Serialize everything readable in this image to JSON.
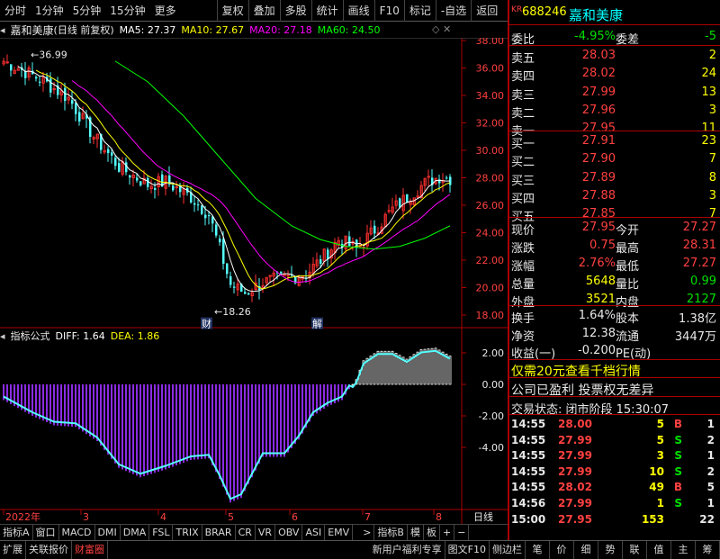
{
  "toolbar": {
    "items": [
      "分时",
      "1分钟",
      "5分钟",
      "15分钟",
      "更多",
      "复权",
      "叠加",
      "多股",
      "统计",
      "画线",
      "F10",
      "标记",
      "-自选",
      "返回"
    ]
  },
  "chart": {
    "stock_name": "嘉和美康",
    "period": "(日线 前复权)",
    "ma5": "MA5: 27.37",
    "ma10": "MA10: 27.67",
    "ma20": "MA20: 27.18",
    "ma60": "MA60: 24.50",
    "high_label": "36.99",
    "low_label": "18.26",
    "marker_cai": "财",
    "marker_jie": "解",
    "y_ticks": [
      "38.00",
      "36.00",
      "34.00",
      "32.00",
      "30.00",
      "28.00",
      "26.00",
      "24.00",
      "22.00",
      "20.00",
      "18.00"
    ],
    "x_labels": [
      "2022年",
      "3",
      "4",
      "5",
      "6",
      "7",
      "8"
    ],
    "period_label": "日线",
    "colors": {
      "ma5": "#ffffff",
      "ma10": "#ffff00",
      "ma20": "#ff00ff",
      "ma60": "#00ff00",
      "up": "#ff3030",
      "down": "#54ffff"
    }
  },
  "indicator": {
    "name": "指标公式",
    "diff": "DIFF: 1.64",
    "dea": "DEA: 1.86",
    "y_ticks": [
      "2.00",
      "0.00",
      "-2.00",
      "-4.00"
    ]
  },
  "tabs": [
    "指标A",
    "窗口",
    "MACD",
    "DMI",
    "DMA",
    "FSL",
    "TRIX",
    "BRAR",
    "CR",
    "VR",
    "OBV",
    "ASI",
    "EMV",
    ">",
    "指标B",
    "模",
    "板",
    "+",
    "−"
  ],
  "statusbar": {
    "left": [
      "扩展",
      "关联报价",
      "财富圈"
    ],
    "right": [
      "新用户福利专享",
      "图文F10",
      "侧边栏"
    ],
    "buttons": [
      "笔",
      "价",
      "细",
      "势",
      "联",
      "值",
      "主",
      "筹"
    ]
  },
  "quote": {
    "code_prefix": "KR",
    "code": "688246",
    "name": "嘉和美康",
    "weibi_label": "委比",
    "weibi": "-4.95%",
    "weicha_label": "委差",
    "weicha": "-5",
    "asks": [
      {
        "label": "卖五",
        "price": "28.03",
        "vol": "2"
      },
      {
        "label": "卖四",
        "price": "28.02",
        "vol": "24"
      },
      {
        "label": "卖三",
        "price": "27.99",
        "vol": "13"
      },
      {
        "label": "卖二",
        "price": "27.96",
        "vol": "3"
      },
      {
        "label": "卖一",
        "price": "27.95",
        "vol": "11"
      }
    ],
    "bids": [
      {
        "label": "买一",
        "price": "27.91",
        "vol": "23"
      },
      {
        "label": "买二",
        "price": "27.90",
        "vol": "7"
      },
      {
        "label": "买三",
        "price": "27.89",
        "vol": "8"
      },
      {
        "label": "买四",
        "price": "27.88",
        "vol": "3"
      },
      {
        "label": "买五",
        "price": "27.85",
        "vol": "7"
      }
    ],
    "stats": [
      {
        "l1": "现价",
        "v1": "27.95",
        "l2": "今开",
        "v2": "27.27"
      },
      {
        "l1": "涨跌",
        "v1": "0.75",
        "l2": "最高",
        "v2": "28.31"
      },
      {
        "l1": "涨幅",
        "v1": "2.76%",
        "l2": "最低",
        "v2": "27.27"
      },
      {
        "l1": "总量",
        "v1": "5648",
        "l2": "量比",
        "v2": "0.99"
      },
      {
        "l1": "外盘",
        "v1": "3521",
        "l2": "内盘",
        "v2": "2127"
      }
    ],
    "stats2": [
      {
        "l1": "换手",
        "v1": "1.64%",
        "l2": "股本",
        "v2": "1.38亿"
      },
      {
        "l1": "净资",
        "v1": "12.38",
        "l2": "流通",
        "v2": "3447万"
      },
      {
        "l1": "收益(一)",
        "v1": "-0.200",
        "l2": "PE(动)",
        "v2": ""
      }
    ],
    "promo": "仅需20元查看千档行情",
    "notice": "公司已盈利 投票权无差异",
    "trade_status": "交易状态: 闭市阶段 15:30:07",
    "ticks": [
      {
        "t": "14:55",
        "p": "28.00",
        "v": "5",
        "f": "B",
        "n": "1"
      },
      {
        "t": "14:55",
        "p": "27.99",
        "v": "5",
        "f": "S",
        "n": "2"
      },
      {
        "t": "14:55",
        "p": "27.99",
        "v": "3",
        "f": "S",
        "n": "1"
      },
      {
        "t": "14:55",
        "p": "27.99",
        "v": "10",
        "f": "S",
        "n": "2"
      },
      {
        "t": "14:55",
        "p": "28.02",
        "v": "49",
        "f": "B",
        "n": "5"
      },
      {
        "t": "14:56",
        "p": "27.99",
        "v": "1",
        "f": "S",
        "n": "1"
      },
      {
        "t": "15:00",
        "p": "27.95",
        "v": "153",
        "f": "",
        "n": "22"
      }
    ]
  }
}
